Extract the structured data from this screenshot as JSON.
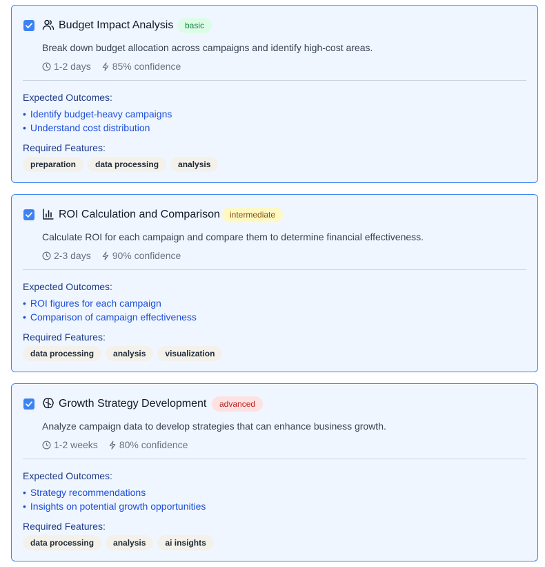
{
  "colors": {
    "accent": "#3b82f6",
    "card_bg": "#eff6ff",
    "link": "#1d4ed8"
  },
  "cards": [
    {
      "icon": "users-icon",
      "checked": true,
      "title": "Budget Impact Analysis",
      "level": "basic",
      "description": "Break down budget allocation across campaigns and identify high-cost areas.",
      "duration": "1-2 days",
      "confidence": "85% confidence",
      "outcomes_label": "Expected Outcomes:",
      "outcomes": [
        "Identify budget-heavy campaigns",
        "Understand cost distribution"
      ],
      "features_label": "Required Features:",
      "features": [
        "preparation",
        "data processing",
        "analysis"
      ]
    },
    {
      "icon": "bar-chart-icon",
      "checked": true,
      "title": "ROI Calculation and Comparison",
      "level": "intermediate",
      "description": "Calculate ROI for each campaign and compare them to determine financial effectiveness.",
      "duration": "2-3 days",
      "confidence": "90% confidence",
      "outcomes_label": "Expected Outcomes:",
      "outcomes": [
        "ROI figures for each campaign",
        "Comparison of campaign effectiveness"
      ],
      "features_label": "Required Features:",
      "features": [
        "data processing",
        "analysis",
        "visualization"
      ]
    },
    {
      "icon": "brain-icon",
      "checked": true,
      "title": "Growth Strategy Development",
      "level": "advanced",
      "description": "Analyze campaign data to develop strategies that can enhance business growth.",
      "duration": "1-2 weeks",
      "confidence": "80% confidence",
      "outcomes_label": "Expected Outcomes:",
      "outcomes": [
        "Strategy recommendations",
        "Insights on potential growth opportunities"
      ],
      "features_label": "Required Features:",
      "features": [
        "data processing",
        "analysis",
        "ai insights"
      ]
    }
  ]
}
